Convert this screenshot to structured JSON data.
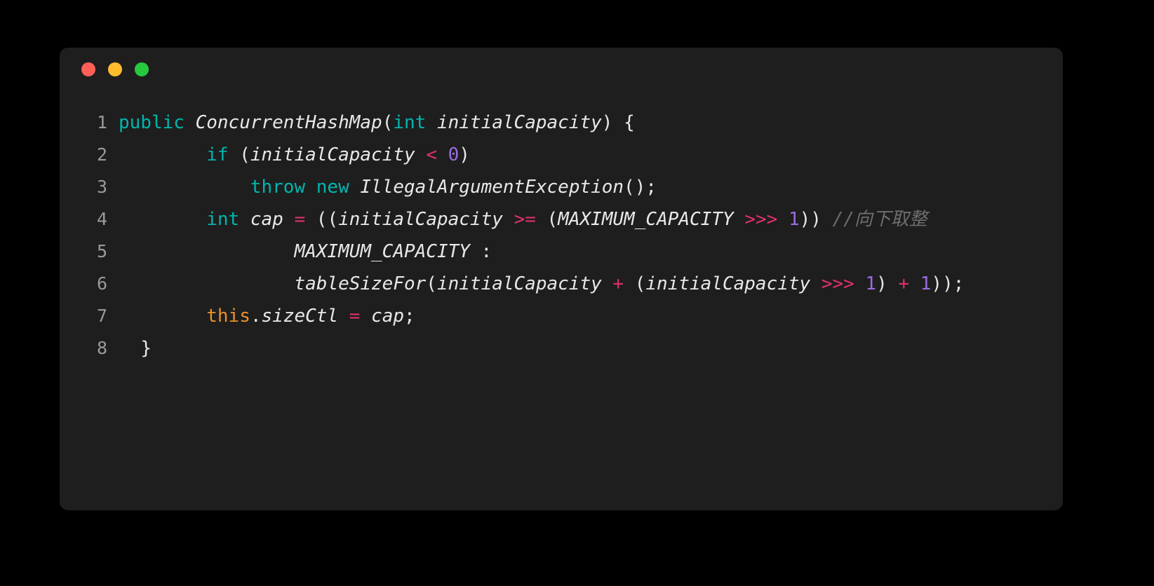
{
  "window": {
    "titlebar": {
      "close_label": "close",
      "minimize_label": "minimize",
      "maximize_label": "maximize"
    },
    "colors": {
      "page_background": "#000000",
      "card_background": "#1E1E1E",
      "close_dot": "#FF5F56",
      "minimize_dot": "#FFBD2E",
      "maximize_dot": "#27C93F",
      "line_number": "#9A9A9A",
      "default_text": "#E8E8E8",
      "keyword": "#00B5AD",
      "this_keyword": "#E8912D",
      "operator": "#E0306E",
      "number": "#9A6CE0",
      "comment": "#6E6E6E"
    }
  },
  "code": {
    "language": "java",
    "line_numbers": [
      "1",
      "2",
      "3",
      "4",
      "5",
      "6",
      "7",
      "8"
    ],
    "lines": [
      {
        "number": "1",
        "text": "public ConcurrentHashMap(int initialCapacity) {",
        "tokens": [
          {
            "t": "public",
            "c": "kw"
          },
          {
            "t": " ",
            "c": "plain"
          },
          {
            "t": "ConcurrentHashMap",
            "c": "ident"
          },
          {
            "t": "(",
            "c": "punct"
          },
          {
            "t": "int",
            "c": "kw"
          },
          {
            "t": " ",
            "c": "plain"
          },
          {
            "t": "initialCapacity",
            "c": "ident"
          },
          {
            "t": ") {",
            "c": "punct"
          }
        ]
      },
      {
        "number": "2",
        "text": "        if (initialCapacity < 0)",
        "tokens": [
          {
            "t": "        ",
            "c": "plain"
          },
          {
            "t": "if",
            "c": "kw"
          },
          {
            "t": " (",
            "c": "punct"
          },
          {
            "t": "initialCapacity",
            "c": "ident"
          },
          {
            "t": " ",
            "c": "plain"
          },
          {
            "t": "<",
            "c": "op"
          },
          {
            "t": " ",
            "c": "plain"
          },
          {
            "t": "0",
            "c": "num"
          },
          {
            "t": ")",
            "c": "punct"
          }
        ]
      },
      {
        "number": "3",
        "text": "            throw new IllegalArgumentException();",
        "tokens": [
          {
            "t": "            ",
            "c": "plain"
          },
          {
            "t": "throw",
            "c": "kw"
          },
          {
            "t": " ",
            "c": "plain"
          },
          {
            "t": "new",
            "c": "kw"
          },
          {
            "t": " ",
            "c": "plain"
          },
          {
            "t": "IllegalArgumentException",
            "c": "ident"
          },
          {
            "t": "();",
            "c": "punct"
          }
        ]
      },
      {
        "number": "4",
        "text": "        int cap = ((initialCapacity >= (MAXIMUM_CAPACITY >>> 1)) //向下取整",
        "tokens": [
          {
            "t": "        ",
            "c": "plain"
          },
          {
            "t": "int",
            "c": "kw"
          },
          {
            "t": " ",
            "c": "plain"
          },
          {
            "t": "cap",
            "c": "ident"
          },
          {
            "t": " ",
            "c": "plain"
          },
          {
            "t": "=",
            "c": "op"
          },
          {
            "t": " ((",
            "c": "punct"
          },
          {
            "t": "initialCapacity",
            "c": "ident"
          },
          {
            "t": " ",
            "c": "plain"
          },
          {
            "t": ">=",
            "c": "op"
          },
          {
            "t": " (",
            "c": "punct"
          },
          {
            "t": "MAXIMUM_CAPACITY",
            "c": "ident"
          },
          {
            "t": " ",
            "c": "plain"
          },
          {
            "t": ">>>",
            "c": "op"
          },
          {
            "t": " ",
            "c": "plain"
          },
          {
            "t": "1",
            "c": "num"
          },
          {
            "t": ")) ",
            "c": "punct"
          },
          {
            "t": "//向下取整",
            "c": "comment"
          }
        ]
      },
      {
        "number": "5",
        "text": "                MAXIMUM_CAPACITY :",
        "tokens": [
          {
            "t": "                ",
            "c": "plain"
          },
          {
            "t": "MAXIMUM_CAPACITY",
            "c": "ident"
          },
          {
            "t": " :",
            "c": "punct"
          }
        ]
      },
      {
        "number": "6",
        "text": "                tableSizeFor(initialCapacity + (initialCapacity >>> 1) + 1));",
        "tokens": [
          {
            "t": "                ",
            "c": "plain"
          },
          {
            "t": "tableSizeFor",
            "c": "ident"
          },
          {
            "t": "(",
            "c": "punct"
          },
          {
            "t": "initialCapacity",
            "c": "ident"
          },
          {
            "t": " ",
            "c": "plain"
          },
          {
            "t": "+",
            "c": "op"
          },
          {
            "t": " (",
            "c": "punct"
          },
          {
            "t": "initialCapacity",
            "c": "ident"
          },
          {
            "t": " ",
            "c": "plain"
          },
          {
            "t": ">>>",
            "c": "op"
          },
          {
            "t": " ",
            "c": "plain"
          },
          {
            "t": "1",
            "c": "num"
          },
          {
            "t": ") ",
            "c": "punct"
          },
          {
            "t": "+",
            "c": "op"
          },
          {
            "t": " ",
            "c": "plain"
          },
          {
            "t": "1",
            "c": "num"
          },
          {
            "t": "));",
            "c": "punct"
          }
        ]
      },
      {
        "number": "7",
        "text": "        this.sizeCtl = cap;",
        "tokens": [
          {
            "t": "        ",
            "c": "plain"
          },
          {
            "t": "this",
            "c": "this"
          },
          {
            "t": ".",
            "c": "punct"
          },
          {
            "t": "sizeCtl",
            "c": "ident"
          },
          {
            "t": " ",
            "c": "plain"
          },
          {
            "t": "=",
            "c": "op"
          },
          {
            "t": " ",
            "c": "plain"
          },
          {
            "t": "cap",
            "c": "ident"
          },
          {
            "t": ";",
            "c": "punct"
          }
        ]
      },
      {
        "number": "8",
        "text": "    }",
        "tokens": [
          {
            "t": "  }",
            "c": "punct"
          }
        ]
      }
    ]
  }
}
